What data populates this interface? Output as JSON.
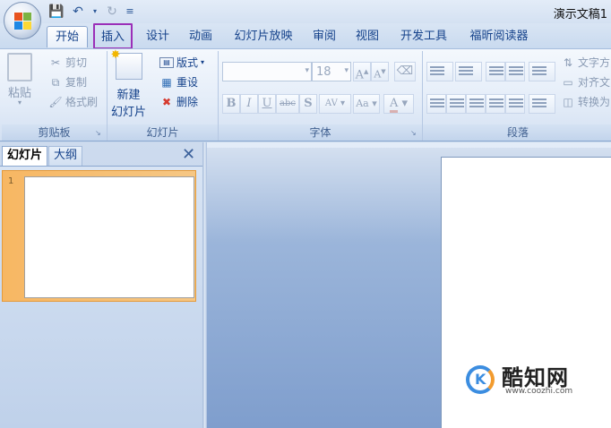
{
  "window": {
    "doc_title": "演示文稿1"
  },
  "qat": {
    "save": "save-icon",
    "undo": "undo-icon",
    "redo": "redo-icon",
    "customize": "customize-icon"
  },
  "tabs": [
    {
      "label": "开始",
      "active": true
    },
    {
      "label": "插入",
      "highlighted": true
    },
    {
      "label": "设计"
    },
    {
      "label": "动画"
    },
    {
      "label": "幻灯片放映"
    },
    {
      "label": "审阅"
    },
    {
      "label": "视图"
    },
    {
      "label": "开发工具"
    },
    {
      "label": "福昕阅读器"
    }
  ],
  "ribbon": {
    "clipboard": {
      "paste": "粘贴",
      "cut": "剪切",
      "copy": "复制",
      "format_painter": "格式刷",
      "label": "剪贴板"
    },
    "slides": {
      "new_slide_line1": "新建",
      "new_slide_line2": "幻灯片",
      "layout": "版式",
      "reset": "重设",
      "delete": "删除",
      "label": "幻灯片"
    },
    "font": {
      "font_size": "18",
      "bold": "B",
      "italic": "I",
      "underline": "U",
      "strike": "abc",
      "shadow": "S",
      "spacing": "AV",
      "case": "Aa",
      "color": "A",
      "grow": "A",
      "shrink": "A",
      "label": "字体"
    },
    "paragraph": {
      "text_direction": "文字方",
      "align_text": "对齐文",
      "convert": "转换为",
      "label": "段落"
    }
  },
  "left_panel": {
    "tab_slides": "幻灯片",
    "tab_outline": "大纲",
    "close": "✕",
    "slide_number": "1"
  },
  "watermark": {
    "name": "酷知网",
    "url": "www.coozhi.com",
    "logo_letter": "K"
  },
  "colors": {
    "highlight": "#9b2fb8",
    "ribbon_text": "#15428b",
    "selection": "#f7b763"
  }
}
